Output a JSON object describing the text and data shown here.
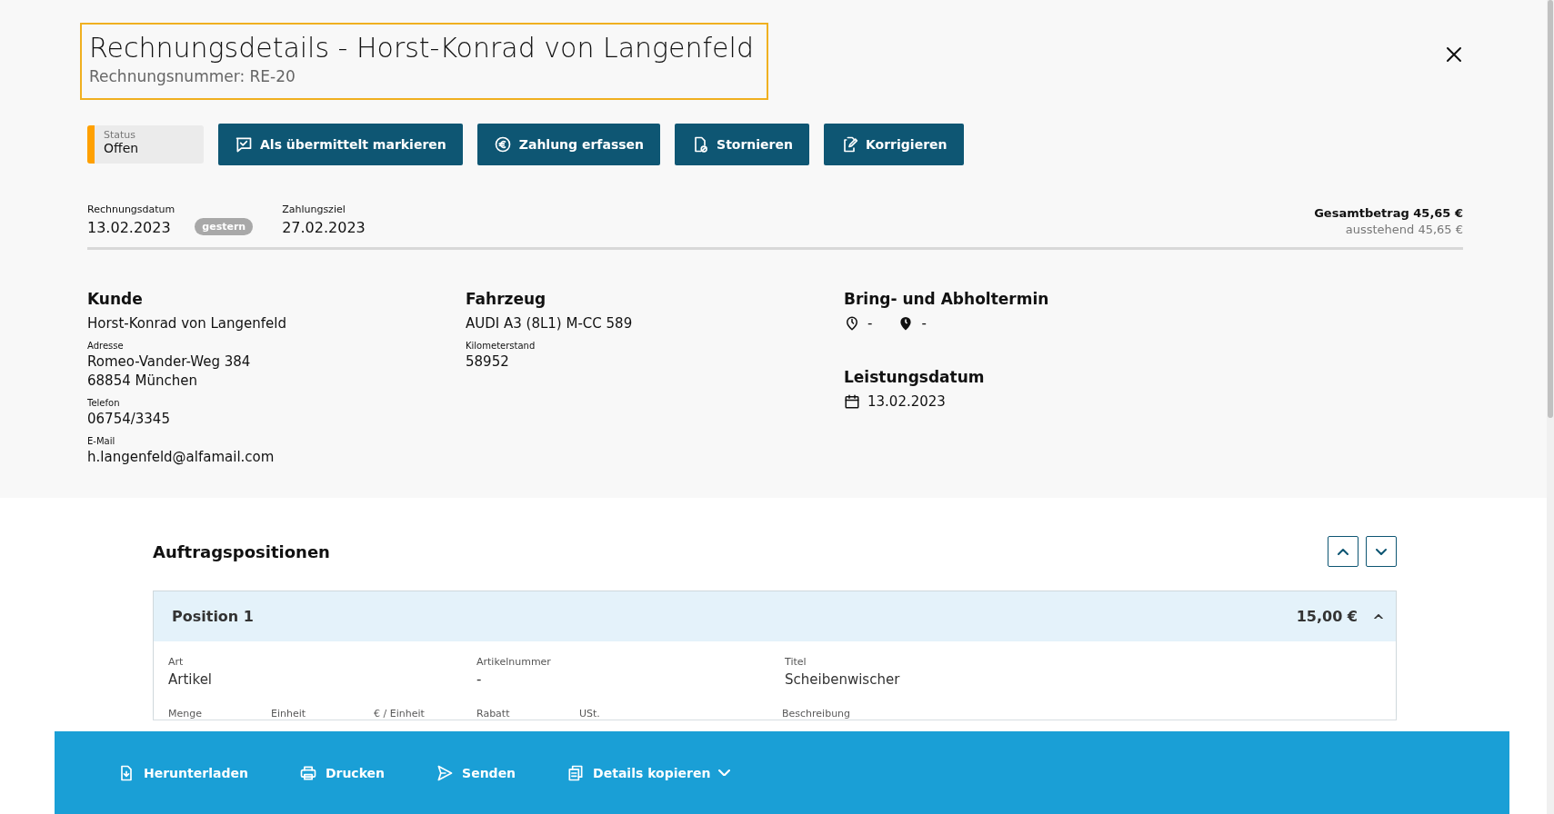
{
  "header": {
    "title": "Rechnungsdetails - Horst-Konrad von Langenfeld",
    "subtitle": "Rechnungsnummer: RE-20"
  },
  "status": {
    "label": "Status",
    "value": "Offen",
    "color": "#ffa000"
  },
  "actions": [
    {
      "kind": "check",
      "label": "Als übermittelt markieren"
    },
    {
      "kind": "euro",
      "label": "Zahlung erfassen"
    },
    {
      "kind": "cancel",
      "label": "Stornieren"
    },
    {
      "kind": "edit",
      "label": "Korrigieren"
    }
  ],
  "dates": {
    "invoice_date_label": "Rechnungsdatum",
    "invoice_date": "13.02.2023",
    "badge": "gestern",
    "due_label": "Zahlungsziel",
    "due": "27.02.2023"
  },
  "totals": {
    "total": "Gesamtbetrag 45,65 €",
    "outstanding": "ausstehend 45,65 €"
  },
  "customer": {
    "heading": "Kunde",
    "name": "Horst-Konrad von Langenfeld",
    "fields": [
      {
        "label": "Adresse",
        "lines": [
          "Romeo-Vander-Weg 384",
          "68854 München"
        ]
      },
      {
        "label": "Telefon",
        "lines": [
          "06754/3345"
        ]
      },
      {
        "label": "E-Mail",
        "lines": [
          "h.langenfeld@alfamail.com"
        ]
      }
    ]
  },
  "vehicle": {
    "heading": "Fahrzeug",
    "name": "AUDI A3 (8L1) M-CC 589",
    "fields": [
      {
        "label": "Kilometerstand",
        "lines": [
          "58952"
        ]
      }
    ]
  },
  "appointment": {
    "heading": "Bring- und Abholtermin",
    "bring": "-",
    "pickup": "-"
  },
  "service_date": {
    "heading": "Leistungsdatum",
    "date": "13.02.2023"
  },
  "positions": {
    "heading": "Auftragspositionen",
    "items": [
      {
        "title": "Position 1",
        "amount": "15,00 €",
        "expanded": true,
        "fields": [
          {
            "label": "Art",
            "value": "Artikel"
          },
          {
            "label": "Artikelnummer",
            "value": "-"
          },
          {
            "label": "Titel",
            "value": "Scheibenwischer"
          }
        ],
        "labels": [
          "Menge",
          "Einheit",
          "€ / Einheit",
          "Rabatt",
          "USt.",
          "Beschreibung"
        ]
      }
    ]
  },
  "bottom_bar": [
    {
      "kind": "download",
      "label": "Herunterladen"
    },
    {
      "kind": "print",
      "label": "Drucken"
    },
    {
      "kind": "send",
      "label": "Senden"
    },
    {
      "kind": "copy",
      "label": "Details kopieren",
      "dropdown": true
    }
  ]
}
